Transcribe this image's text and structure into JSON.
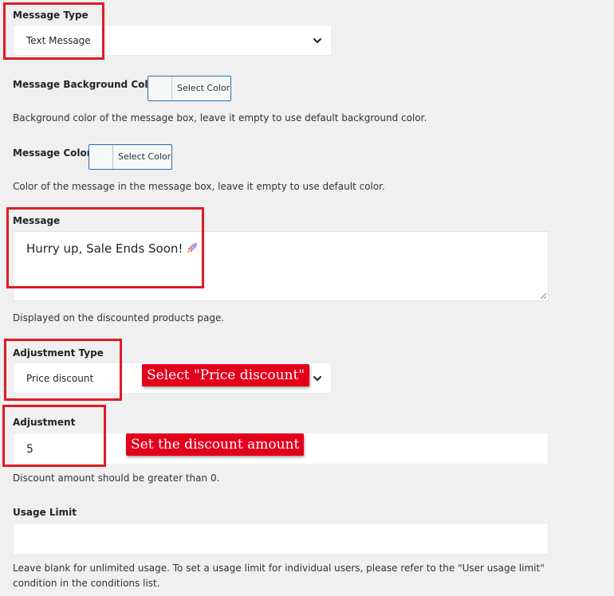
{
  "message_type": {
    "label": "Message Type",
    "selected": "Text Message"
  },
  "message_bg_color": {
    "label": "Message Background Color",
    "button_label": "Select Color",
    "description": "Background color of the message box, leave it empty to use default background color."
  },
  "message_color": {
    "label": "Message Color",
    "button_label": "Select Color",
    "description": "Color of the message in the message box, leave it empty to use default color."
  },
  "message": {
    "label": "Message",
    "value": "Hurry up, Sale Ends Soon!",
    "icon": "rocket-icon",
    "description": "Displayed on the discounted products page."
  },
  "adjustment_type": {
    "label": "Adjustment Type",
    "selected": "Price discount",
    "callout": "Select \"Price discount\""
  },
  "adjustment": {
    "label": "Adjustment",
    "value": "5",
    "callout": "Set the discount amount",
    "description": "Discount amount should be greater than 0."
  },
  "usage_limit": {
    "label": "Usage Limit",
    "value": "",
    "description_line1": "Leave blank for unlimited usage. To set a usage limit for individual users, please refer to the \"User usage limit\"",
    "description_line2": "condition in the conditions list."
  },
  "colors": {
    "highlight_border": "#e01b24",
    "callout_bg": "#e4001b",
    "button_border": "#2271b1",
    "page_bg": "#f0f0f1"
  }
}
